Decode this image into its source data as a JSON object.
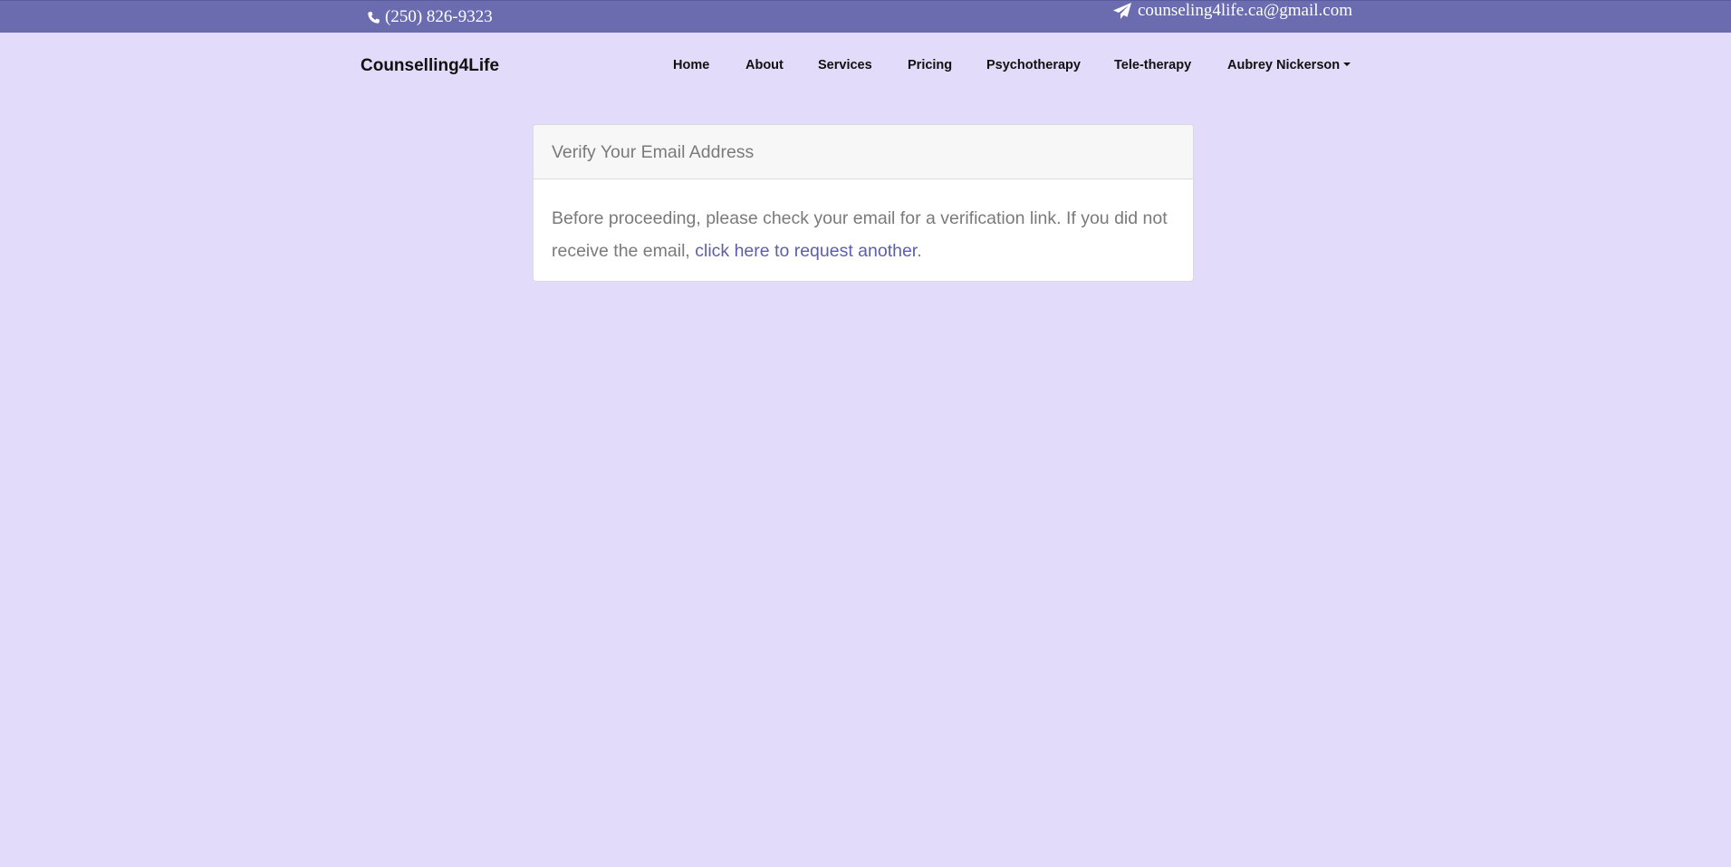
{
  "topbar": {
    "phone": "(250) 826-9323",
    "phone_icon": "phone-icon",
    "email": "counseling4life.ca@gmail.com",
    "email_icon": "paper-plane-icon",
    "background_color": "#6b6bb0"
  },
  "navbar": {
    "brand": "Counselling4Life",
    "items": [
      {
        "label": "Home"
      },
      {
        "label": "About"
      },
      {
        "label": "Services"
      },
      {
        "label": "Pricing"
      },
      {
        "label": "Psychotherapy"
      },
      {
        "label": "Tele-therapy"
      },
      {
        "label": "Aubrey Nickerson"
      }
    ],
    "dropdown_icon": "caret-down-icon"
  },
  "card": {
    "header": "Verify Your Email Address",
    "body_text": "Before proceeding, please check your email for a verification link. If you did not receive the email,",
    "link_text": "click here to request another",
    "link_suffix": "."
  },
  "colors": {
    "page_background": "#e2dcfa",
    "link": "#5d5fa8",
    "muted_text": "#7a7a7a"
  }
}
